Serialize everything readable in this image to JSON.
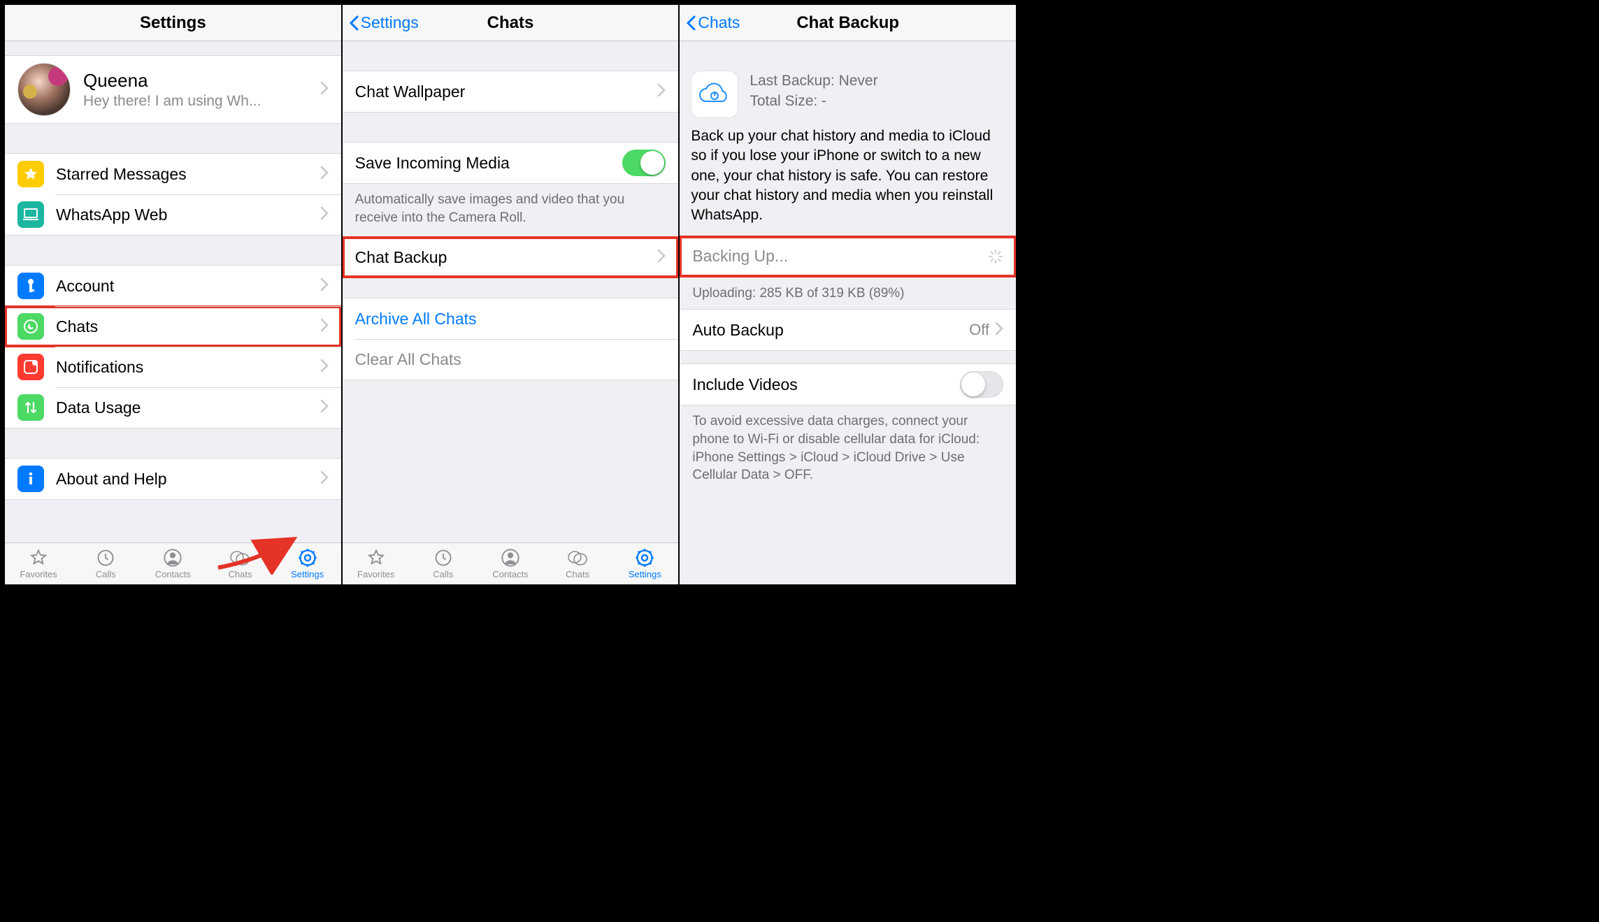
{
  "colors": {
    "accent": "#007aff",
    "highlight": "#e53327",
    "switch_on": "#4cd964"
  },
  "settings": {
    "title": "Settings",
    "profile": {
      "name": "Queena",
      "status": "Hey there! I am using Wh..."
    },
    "rows": {
      "starred": "Starred Messages",
      "web": "WhatsApp Web",
      "account": "Account",
      "chats": "Chats",
      "notifications": "Notifications",
      "data": "Data Usage",
      "about": "About and Help"
    },
    "icon_colors": {
      "starred": "#ffcc00",
      "web": "#1bb6a1",
      "account": "#007aff",
      "chats": "#4cd964",
      "notifications": "#ff3b30",
      "data": "#4cd964",
      "about": "#007aff"
    }
  },
  "chats": {
    "back": "Settings",
    "title": "Chats",
    "wallpaper": "Chat Wallpaper",
    "save_media": "Save Incoming Media",
    "save_media_on": true,
    "save_media_note": "Automatically save images and video that you receive into the Camera Roll.",
    "backup": "Chat Backup",
    "archive": "Archive All Chats",
    "clear": "Clear All Chats"
  },
  "backup": {
    "back": "Chats",
    "title": "Chat Backup",
    "last_backup": "Last Backup: Never",
    "total_size": "Total Size: -",
    "desc": "Back up your chat history and media to iCloud so if you lose your iPhone or switch to a new one, your chat history is safe. You can restore your chat history and media when you reinstall WhatsApp.",
    "backing_up": "Backing Up...",
    "uploading": "Uploading: 285 KB of 319 KB (89%)",
    "auto": "Auto Backup",
    "auto_value": "Off",
    "include_videos": "Include Videos",
    "include_videos_on": false,
    "note": "To avoid excessive data charges, connect your phone to Wi-Fi or disable cellular data for iCloud: iPhone Settings > iCloud > iCloud Drive > Use Cellular Data > OFF."
  },
  "tabs": {
    "favorites": "Favorites",
    "calls": "Calls",
    "contacts": "Contacts",
    "chats": "Chats",
    "settings": "Settings"
  }
}
